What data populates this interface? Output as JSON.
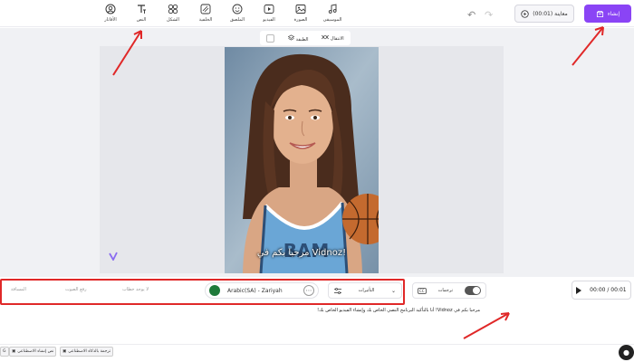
{
  "toolbar": {
    "tools": [
      {
        "label": "الأفاتار",
        "icon": "avatar-icon"
      },
      {
        "label": "النص",
        "icon": "text-icon"
      },
      {
        "label": "الشكل",
        "icon": "shapes-icon"
      },
      {
        "label": "الخلفية",
        "icon": "background-icon"
      },
      {
        "label": "الملصق",
        "icon": "sticker-icon"
      },
      {
        "label": "الفيديو",
        "icon": "video-icon"
      },
      {
        "label": "الصورة",
        "icon": "image-icon"
      },
      {
        "label": "الموسيقى",
        "icon": "music-icon"
      }
    ],
    "preview_label": "معاينة (00:01)",
    "create_label": "إنشاء"
  },
  "mini_bar": {
    "layer_label": "الطبقة",
    "transition_label": "الانتقال"
  },
  "canvas": {
    "caption": "مرحبا بكم في Vidnoz!"
  },
  "controls": {
    "label_left": "المسافة",
    "label_mid1": "رفع الصوت",
    "label_mid2": "لا يوجد خطاب",
    "voice_name": "Arabic(SA) - Zariyah",
    "effects_label": "التأثيرات",
    "subtitles_label": "ترجمات",
    "cc_label": "CC",
    "time_display": "00:00 / 00:01"
  },
  "script_text": "مرحبا بكم في Vidnoz! أنا بالتأكيد البرنامج النصي الخاص بك وإنشاء الفيديو الخاص بك!",
  "bottom": {
    "chip1": "ترجمة بالذكاء الاصطناعي",
    "chip2": "نص إنشاء الاصطناعي",
    "chip3": "G"
  },
  "colors": {
    "accent": "#8a44f5",
    "annotation": "#e02828"
  }
}
